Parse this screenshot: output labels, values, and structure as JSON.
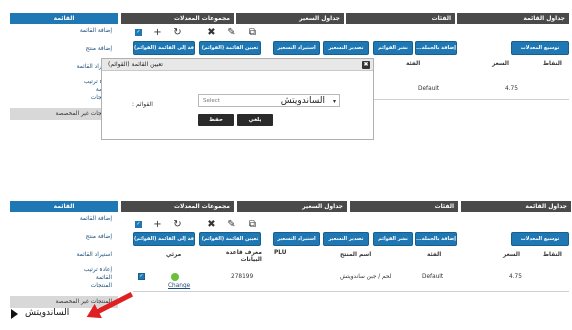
{
  "tabs": {
    "price_lists": "جداول القائمة",
    "categories": "الفئات",
    "pricing_tables": "جداول السعير",
    "modifier_groups": "مجموعات المعدلات",
    "menu": "القائمة"
  },
  "tabs_bottom": {
    "price_lists": "جداول القائمة",
    "categories": "الفئات",
    "pricing_tables": "جداول السعير",
    "modifier_groups": "مجموعات المعدلات",
    "menu": "القائمة"
  },
  "sidebar": {
    "items": [
      {
        "label": "إضافة القائمة"
      },
      {
        "label": "إضافة منتج"
      },
      {
        "label": "استيراد القائمة"
      },
      {
        "label": "إعادة ترتيب\nالقائمة\nالمنتجات"
      },
      {
        "label": "المنتجات غير المخصصة"
      }
    ]
  },
  "sidebar_bottom": {
    "items": [
      {
        "label": "إضافة القائمة"
      },
      {
        "label": "إضافة منتج"
      },
      {
        "label": "استيراد القائمة"
      },
      {
        "label": "إعادة ترتيب\nالقائمة\nالمنتجات"
      },
      {
        "label": "المنتجات غير المخصصة"
      }
    ]
  },
  "toolbar": {
    "check_glyph": "✓",
    "add_icon": "+",
    "refresh_icon": "↻",
    "delete_icon": "✖",
    "edit_icon": "✎",
    "copy_icon": "⧉"
  },
  "buttons_top": {
    "add_to_menu": "إضافة إلى القائمة (القوائم)",
    "assign_menu": "تعيين القائمة (القوائم)",
    "import_pricing": "استيراد التسعير",
    "export_pricing": "تصدير التسعير",
    "publish_menu": "نشر القوائم",
    "bulk_edit": "...إضافة بالجملة",
    "expand_modifiers": "توسيع المعدلات"
  },
  "buttons_bottom": {
    "add_to_menu": "إضافة إلى القائمة (القوائم)",
    "assign_menu": "تعيين القائمة (القوائم)",
    "import_pricing": "استيراد التسعير",
    "export_pricing": "تصدير التسعير",
    "publish_menu": "نشر القوائم",
    "bulk_edit": "...إضافة بالجملة",
    "expand_modifiers": "توسيع المعدلات"
  },
  "table_top": {
    "headers": {
      "category": "الفئة",
      "price": "السعر",
      "points": "النقاط"
    },
    "row": {
      "category": "Default",
      "price": "4.75"
    }
  },
  "table_bottom": {
    "headers": {
      "visible": "مرئي",
      "db_id": "معرف قاعدة\nالبيانات",
      "plu": "PLU",
      "product_name": "اسم المنتج",
      "category": "الفئة",
      "price": "السعر",
      "points": "النقاط"
    },
    "row": {
      "visible_link": "Change",
      "db_id": "278199",
      "product_name": "لحم / جبن ساندويتش",
      "category": "Default",
      "price": "4.75"
    }
  },
  "modal": {
    "title": "تعيين القائمة (القوائم)",
    "close_glyph": "✖",
    "label": ": القوائم",
    "select_placeholder": "Select",
    "select_value": "الساندويتش",
    "select_arrow": "▾",
    "save_label": "حفظ",
    "cancel_label": "يلغي"
  },
  "bottom_tree": {
    "value": "الساندويتش"
  },
  "colors": {
    "tab_dark": "#4a4a4a",
    "tab_blue": "#1f78b4",
    "button_blue": "#1f78b4",
    "arrow_red": "#e02020",
    "status_green": "#6bbf3a"
  }
}
